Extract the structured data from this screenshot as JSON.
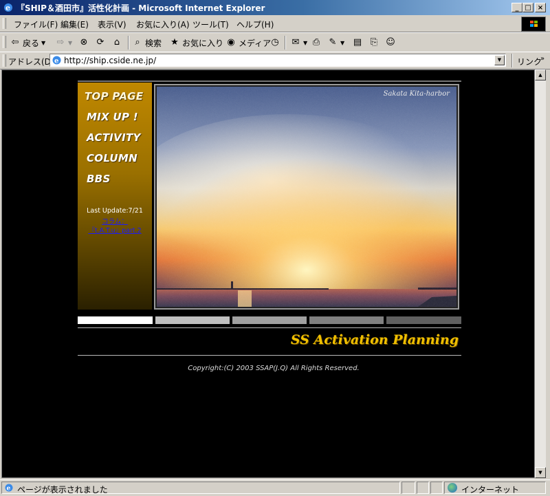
{
  "window": {
    "title": "『SHIP＆酒田市』活性化計画 - Microsoft Internet Explorer",
    "controls": {
      "minimize": "_",
      "maximize": "□",
      "close": "×"
    }
  },
  "menu": [
    "ファイル(F)",
    "編集(E)",
    "表示(V)",
    "お気に入り(A)",
    "ツール(T)",
    "ヘルプ(H)"
  ],
  "toolbar": {
    "back": "戻る",
    "search": "検索",
    "favorites": "お気に入り",
    "media": "メディア"
  },
  "address": {
    "label": "アドレス(D)",
    "url": "http://ship.cside.ne.jp/",
    "links": "リンク"
  },
  "status": {
    "text": "ページが表示されました",
    "zone": "インターネット"
  },
  "site": {
    "nav": [
      "TOP PAGE",
      "MIX UP !",
      "ACTIVITY",
      "COLUMN",
      "BBS"
    ],
    "last_update": "Last Update:7/21",
    "update_link_1": "コラム：",
    "update_link_2": "『t.A.T.u』part.2",
    "photo_caption": "Sakata Kita-harbor",
    "brand": "SS Activation Planning",
    "copyright": "Copyright:(C) 2003 SSAP(J.Q) All Rights Reserved.",
    "colors": {
      "accent": "#f0c000",
      "nav_gold": "#c08800"
    }
  }
}
